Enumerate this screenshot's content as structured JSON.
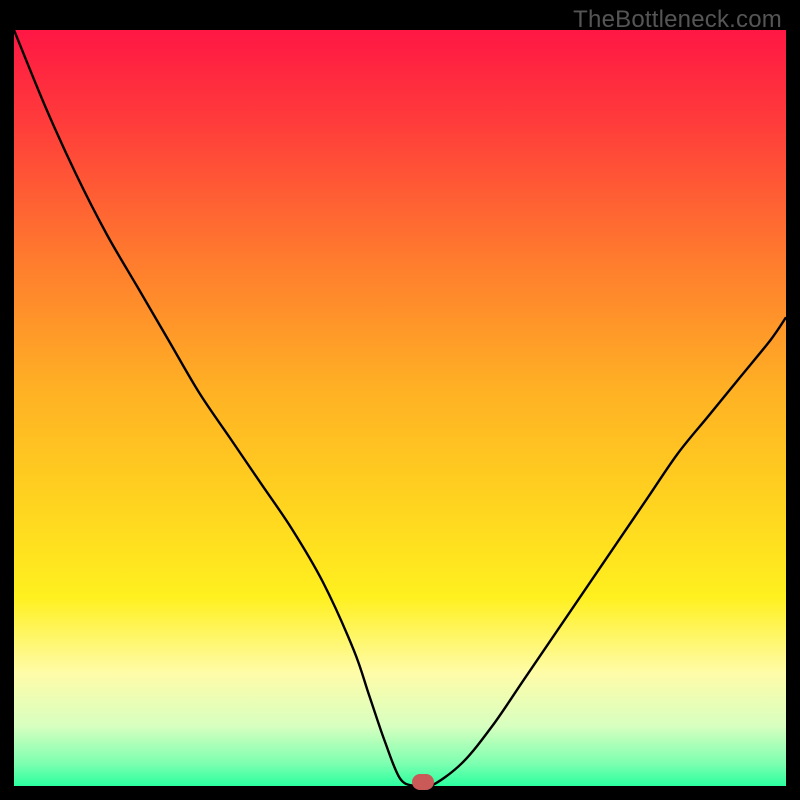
{
  "watermark": "TheBottleneck.com",
  "chart_data": {
    "type": "line",
    "title": "",
    "xlabel": "",
    "ylabel": "",
    "xlim": [
      0,
      100
    ],
    "ylim": [
      0,
      100
    ],
    "grid": false,
    "legend": false,
    "background": {
      "type": "vertical-gradient",
      "stops": [
        {
          "pos": 0.0,
          "color": "#ff1744"
        },
        {
          "pos": 0.12,
          "color": "#ff3b3b"
        },
        {
          "pos": 0.3,
          "color": "#ff7a2e"
        },
        {
          "pos": 0.48,
          "color": "#ffb224"
        },
        {
          "pos": 0.62,
          "color": "#ffd21f"
        },
        {
          "pos": 0.75,
          "color": "#fff01f"
        },
        {
          "pos": 0.85,
          "color": "#fffca8"
        },
        {
          "pos": 0.92,
          "color": "#d8ffc0"
        },
        {
          "pos": 0.97,
          "color": "#7dffb0"
        },
        {
          "pos": 1.0,
          "color": "#2bffa0"
        }
      ]
    },
    "series": [
      {
        "name": "bottleneck-curve",
        "color": "#000000",
        "width": 2.4,
        "x": [
          0,
          4,
          8,
          12,
          16,
          20,
          24,
          28,
          32,
          36,
          40,
          44,
          46,
          48,
          50,
          52,
          54,
          58,
          62,
          66,
          70,
          74,
          78,
          82,
          86,
          90,
          94,
          98,
          100
        ],
        "y": [
          100,
          90,
          81,
          73,
          66,
          59,
          52,
          46,
          40,
          34,
          27,
          18,
          12,
          6,
          1,
          0,
          0,
          3,
          8,
          14,
          20,
          26,
          32,
          38,
          44,
          49,
          54,
          59,
          62
        ]
      }
    ],
    "marker": {
      "name": "optimal-point",
      "x": 53,
      "y": 0,
      "color": "#c95a57"
    }
  }
}
